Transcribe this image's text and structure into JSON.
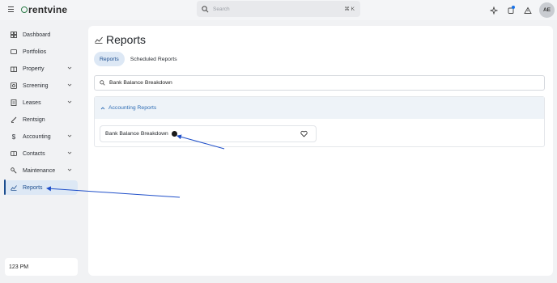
{
  "app": {
    "brand_text": "rentvine"
  },
  "topbar": {
    "search_placeholder": "Search",
    "search_shortcut": "⌘ K",
    "avatar_initials": "AE"
  },
  "sidebar": {
    "items": [
      {
        "label": "Dashboard",
        "icon": "dashboard-icon"
      },
      {
        "label": "Portfolios",
        "icon": "portfolio-icon"
      },
      {
        "label": "Property",
        "icon": "building-icon",
        "expandable": true
      },
      {
        "label": "Screening",
        "icon": "screening-icon",
        "expandable": true
      },
      {
        "label": "Leases",
        "icon": "lease-icon",
        "expandable": true
      },
      {
        "label": "Rentsign",
        "icon": "pen-icon"
      },
      {
        "label": "Accounting",
        "icon": "dollar-icon",
        "expandable": true
      },
      {
        "label": "Contacts",
        "icon": "contacts-icon",
        "expandable": true
      },
      {
        "label": "Maintenance",
        "icon": "wrench-icon",
        "expandable": true
      },
      {
        "label": "Reports",
        "icon": "reports-icon",
        "active": true
      }
    ],
    "time": "123 PM"
  },
  "main": {
    "title": "Reports",
    "tabs": [
      {
        "label": "Reports",
        "active": true
      },
      {
        "label": "Scheduled Reports",
        "active": false
      }
    ],
    "search_value": "Bank Balance Breakdown",
    "section": {
      "title": "Accounting Reports",
      "expanded": true,
      "reports": [
        {
          "name": "Bank Balance Breakdown",
          "favorited": false
        }
      ]
    }
  },
  "colors": {
    "accent": "#1d4e8f",
    "brand_green": "#2e7d4a",
    "link_blue": "#2f6db5",
    "annotation_arrow": "#1f4fc9"
  }
}
